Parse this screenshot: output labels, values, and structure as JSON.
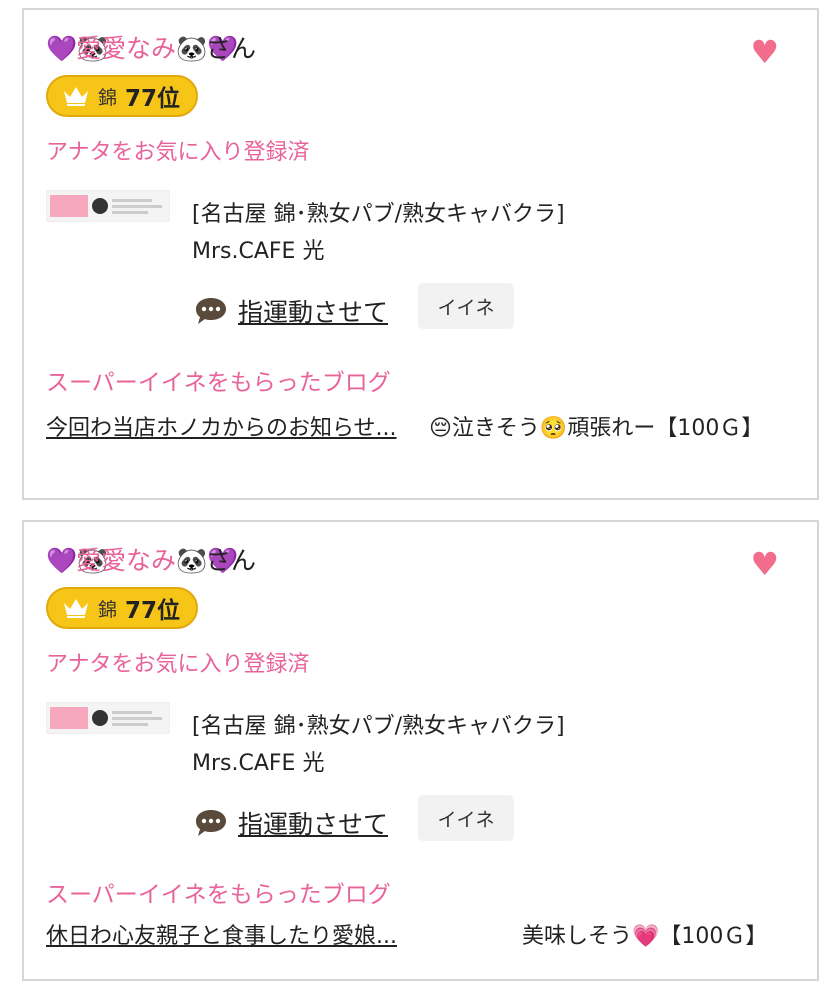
{
  "cards": [
    {
      "name_prefix_emoji": "💜🐼",
      "name": "愛愛なみ",
      "name_suffix_emoji": "🐼💜",
      "honorific": "さん",
      "rank_area": "錦",
      "rank": "77位",
      "favorite_status": "アナタをお気に入り登録済",
      "shop_category": "[名古屋 錦･熟女パブ/熟女キャバクラ]",
      "shop_name": "Mrs.CAFE 光",
      "comment": "指運動させて",
      "iine_label": "イイネ",
      "super_label": "スーパーイイネをもらったブログ",
      "blog_title": "今回わ当店ホノカからのお知らせ...",
      "blog_comment": "😔泣きそう🥺頑張れー【100Ｇ】"
    },
    {
      "name_prefix_emoji": "💜🐼",
      "name": "愛愛なみ",
      "name_suffix_emoji": "🐼💜",
      "honorific": "さん",
      "rank_area": "錦",
      "rank": "77位",
      "favorite_status": "アナタをお気に入り登録済",
      "shop_category": "[名古屋 錦･熟女パブ/熟女キャバクラ]",
      "shop_name": "Mrs.CAFE 光",
      "comment": "指運動させて",
      "iine_label": "イイネ",
      "super_label": "スーパーイイネをもらったブログ",
      "blog_title": "休日わ心友親子と食事したり愛娘...",
      "blog_comment": "美味しそう💗【100Ｇ】"
    }
  ],
  "colors": {
    "pink_text": "#e8639a",
    "heart": "#f26d8c",
    "badge": "#f6c518",
    "border": "#d6d6d6"
  },
  "icons": {
    "favorite": "heart-icon",
    "rank": "crown-icon",
    "comment": "speech-bubble-icon"
  }
}
